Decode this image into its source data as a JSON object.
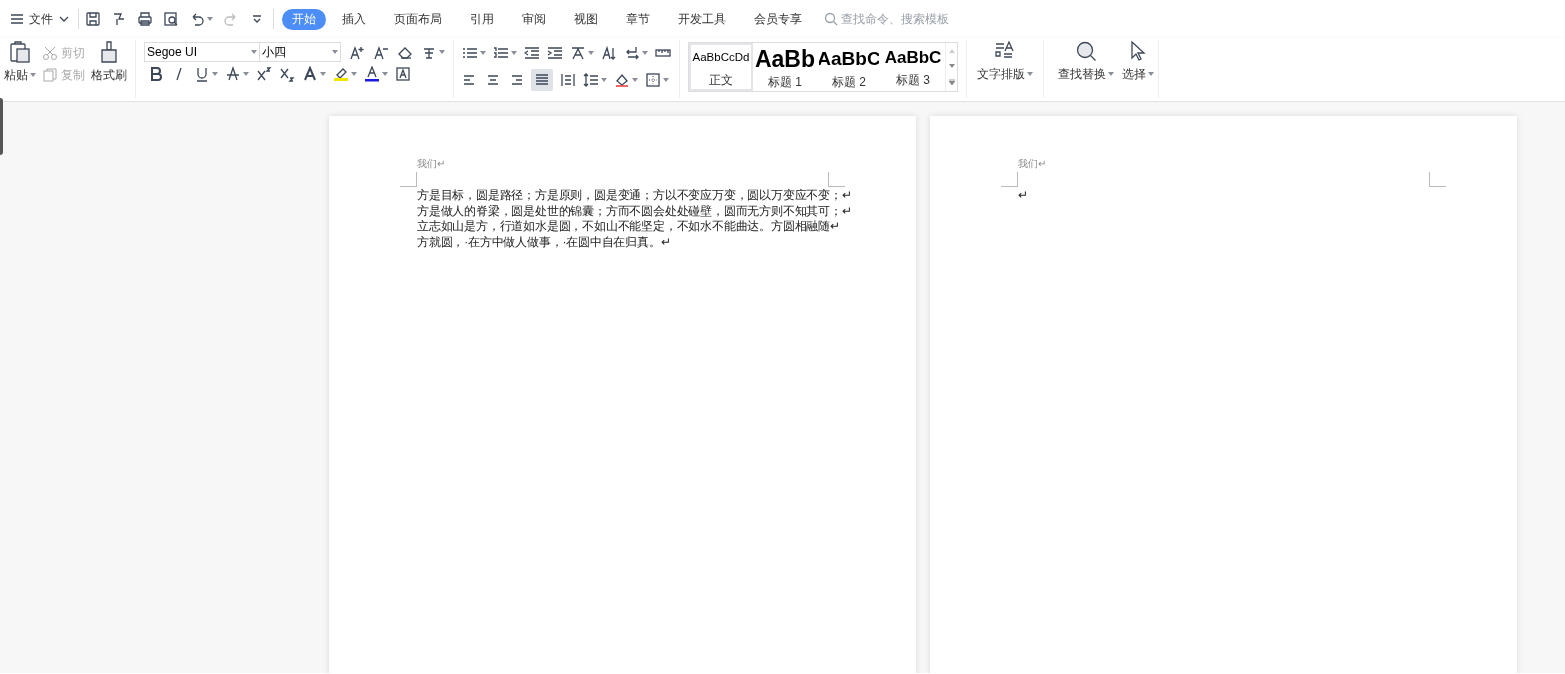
{
  "menu": {
    "label": "文件"
  },
  "tabs": [
    {
      "label": "开始",
      "selected": true
    },
    {
      "label": "插入",
      "selected": false
    },
    {
      "label": "页面布局",
      "selected": false
    },
    {
      "label": "引用",
      "selected": false
    },
    {
      "label": "审阅",
      "selected": false
    },
    {
      "label": "视图",
      "selected": false
    },
    {
      "label": "章节",
      "selected": false
    },
    {
      "label": "开发工具",
      "selected": false
    },
    {
      "label": "会员专享",
      "selected": false
    }
  ],
  "search": {
    "placeholder": "查找命令、搜索模板"
  },
  "clipboard": {
    "paste": "粘贴",
    "cut": {
      "label": "剪切",
      "disabled": true
    },
    "copy": {
      "label": "复制",
      "disabled": true
    },
    "format_painter": "格式刷"
  },
  "font": {
    "family": "Segoe UI",
    "size": "小四"
  },
  "styles": [
    {
      "sample": "AaBbCcDd",
      "label": "正文",
      "selected": true
    },
    {
      "sample": "AaBb",
      "label": "标题 1",
      "selected": false
    },
    {
      "sample": "AaBbC",
      "label": "标题 2",
      "selected": false
    },
    {
      "sample": "AaBbC",
      "label": "标题 3",
      "selected": false
    }
  ],
  "tools": [
    {
      "label": "文字排版"
    },
    {
      "label": "查找替换"
    },
    {
      "label": "选择"
    }
  ],
  "pages": [
    {
      "header": "我们↵",
      "body": [
        "方是目标，圆是路径；方是原则，圆是变通；方以不变应万变，圆以万变应不变；↵",
        "方是做人的脊梁，圆是处世的锦囊；方而不圆会处处碰壁，圆而无方则不知其可；↵",
        "立志如山是方，行道如水是圆，不如山不能坚定，不如水不能曲达。方圆相融随↵",
        "方就圆，·在方中做人做事，·在圆中自在归真。↵"
      ]
    },
    {
      "header": "我们↵",
      "body": [
        "↵"
      ]
    }
  ]
}
